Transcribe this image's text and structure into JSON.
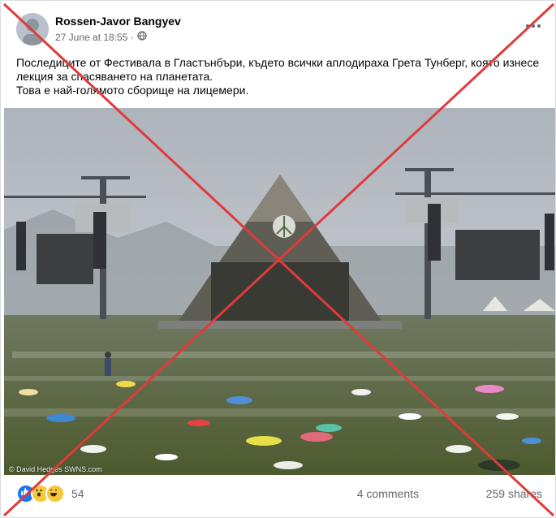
{
  "post": {
    "author": "Rossen-Javor Bangyev",
    "timestamp": "27 June at 18:55",
    "privacy_icon": "globe-icon",
    "text_lines": [
      "Последиците от Фестивала в Гластънбъри, където всички аплодираха Грета Тунберг, която изнесе",
      "лекция за спасяването на планетата.",
      "Това е най-голямото сборище на лицемери."
    ],
    "photo_credit": "© David Hedges SWNS.com"
  },
  "reactions": {
    "icons": [
      "like-icon",
      "wow-icon",
      "haha-icon"
    ],
    "count": "54"
  },
  "stats": {
    "comments": "4 comments",
    "shares": "259 shares"
  },
  "overlay": {
    "cross_color": "#e03a3a"
  }
}
